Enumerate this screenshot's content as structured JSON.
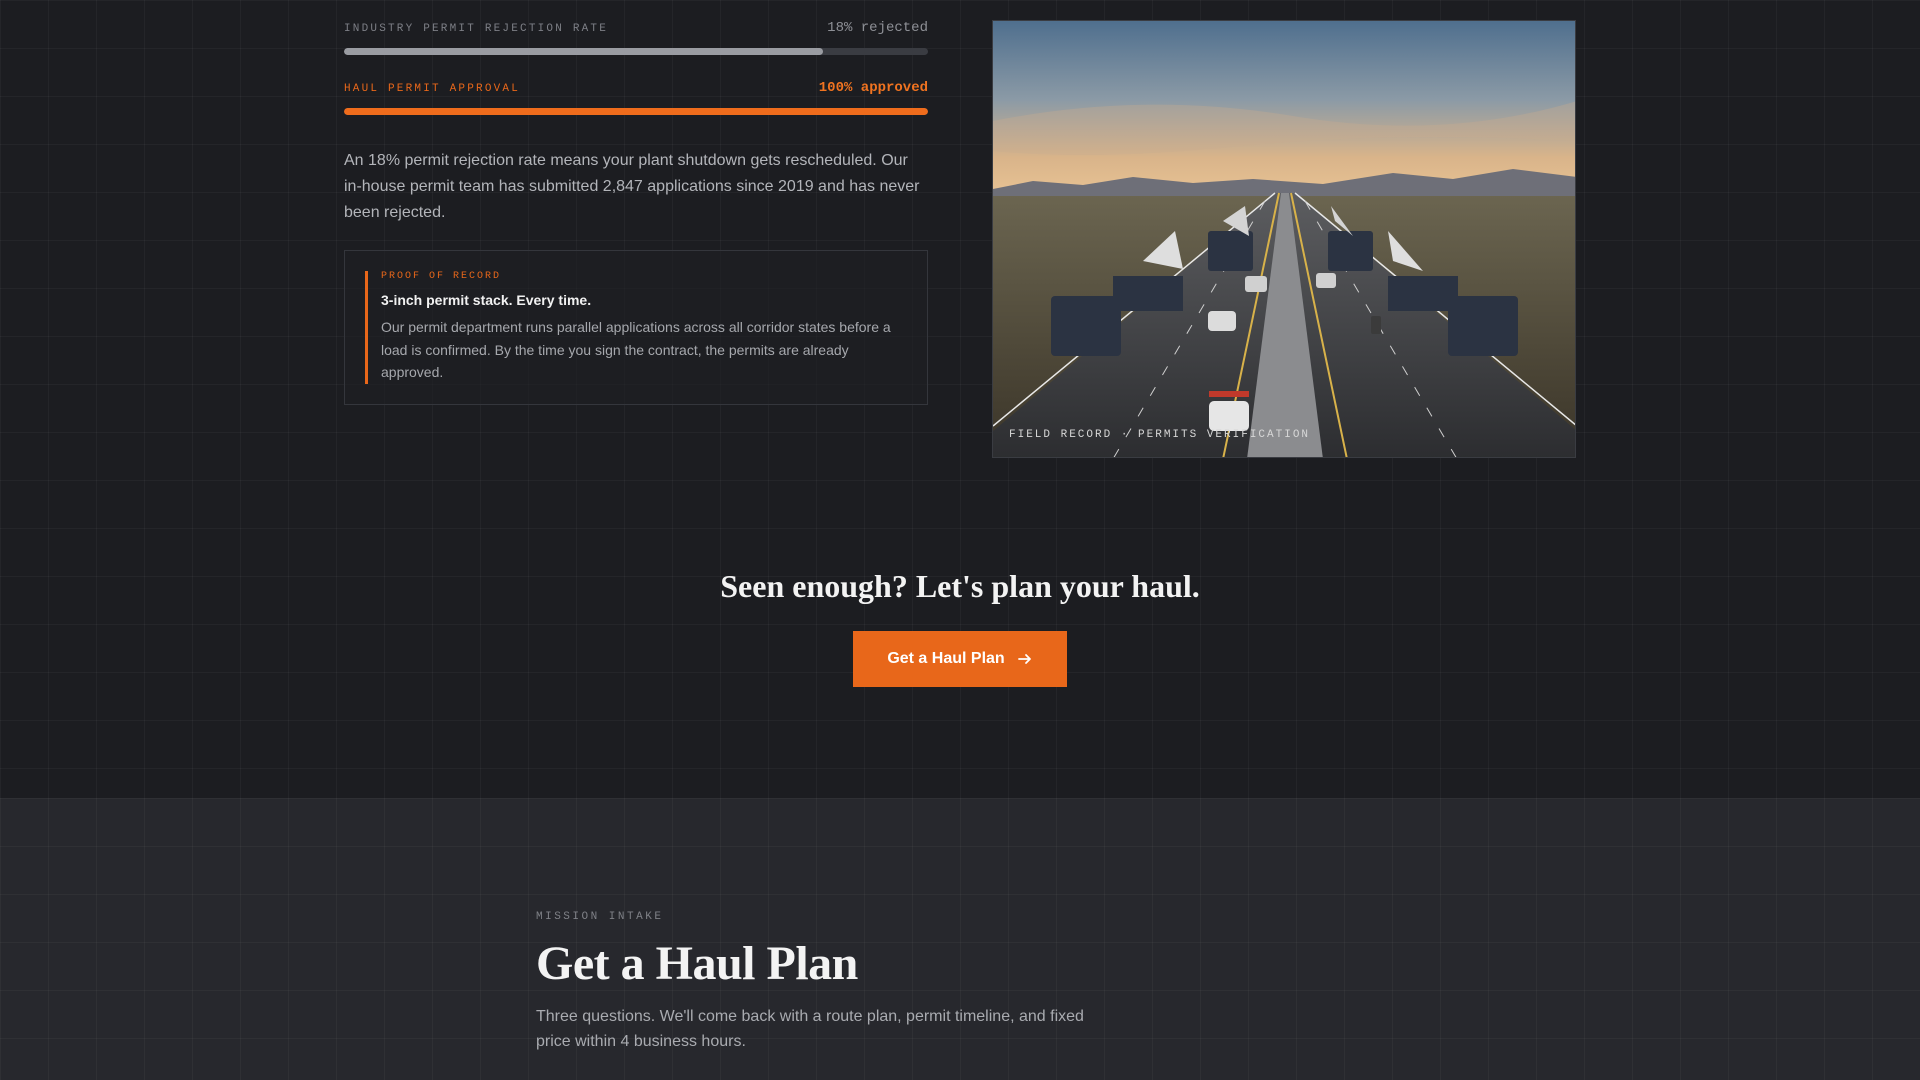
{
  "stats": {
    "industry": {
      "label": "INDUSTRY PERMIT REJECTION RATE",
      "value": "18% rejected",
      "bar_fraction": 0.82
    },
    "haul": {
      "label": "HAUL PERMIT APPROVAL",
      "value": "100% approved",
      "bar_fraction": 1.0
    }
  },
  "body_text": "An 18% permit rejection rate means your plant shutdown gets rescheduled. Our in-house permit team has submitted 2,847 applications since 2019 and has never been rejected.",
  "proof": {
    "tag": "PROOF OF RECORD",
    "title": "3-inch permit stack. Every time.",
    "text": "Our permit department runs parallel applications across all corridor states before a load is confirmed. By the time you sign the contract, the permits are already approved."
  },
  "photo": {
    "caption": "FIELD RECORD · PERMITS VERIFICATION"
  },
  "cta": {
    "title": "Seen enough? Let's plan your haul.",
    "button_label": "Get a Haul Plan",
    "button_icon": "arrow-right-icon"
  },
  "intake": {
    "tag": "MISSION INTAKE",
    "title": "Get a Haul Plan",
    "text": "Three questions. We'll come back with a route plan, permit timeline, and fixed price within 4 business hours."
  },
  "colors": {
    "accent": "#e8671a",
    "background": "#1c1d21",
    "section_background": "#27282d"
  }
}
